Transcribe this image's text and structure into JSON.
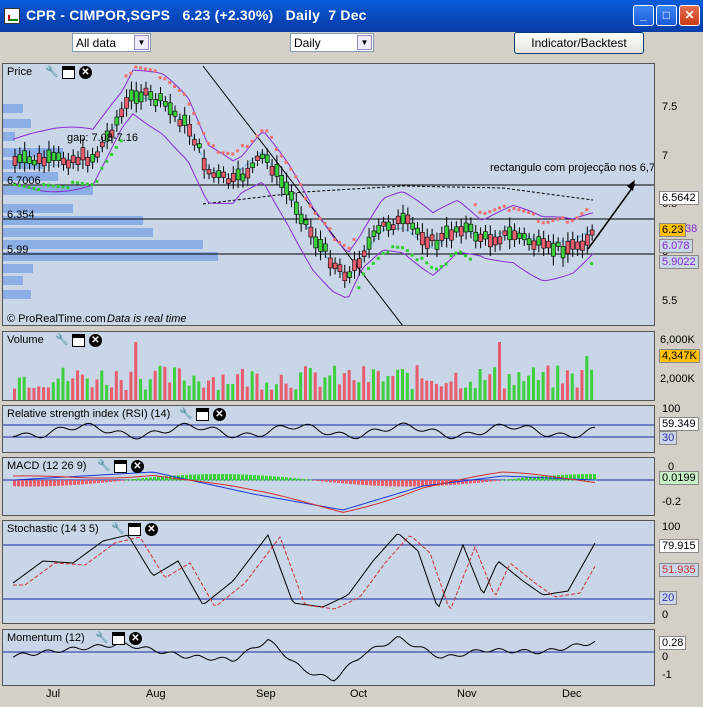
{
  "window": {
    "title": "CPR - CIMPOR,SGPS   6.23 (+2.30%)   Daily  7 Dec",
    "buttons": {
      "minimize": "_",
      "maximize": "□",
      "close": "✕"
    }
  },
  "toolbar": {
    "range_select": "All data",
    "interval_select": "Daily",
    "indicator_button": "Indicator/Backtest"
  },
  "panels": {
    "price": {
      "title": "Price",
      "y_ticks": [
        "7.5",
        "7",
        "6.5",
        "6",
        "5.5"
      ],
      "badges": {
        "top": "6.5642",
        "last": "6.23",
        "last_suffix": "38",
        "mid": "6.078",
        "low": "5.9022"
      },
      "level_labels": [
        "6.7006",
        "6.354",
        "5.99"
      ],
      "annotations": {
        "gap": "gap: 7.08-7.16",
        "rect": "rectangulo com projecção nos 6,7"
      },
      "footer_brand": "© ProRealTime.com",
      "footer_note": "Data is real time",
      "colors": {
        "up": "#3cd03c",
        "down": "#e85c6c",
        "bollinger": "#8a2bd0",
        "sar_up": "#2fcf2f",
        "sar_down": "#f07070"
      }
    },
    "volume": {
      "title": "Volume",
      "y_ticks": [
        "6,000K",
        "2,000K"
      ],
      "badge": "4,347K"
    },
    "rsi": {
      "title": "Relative strength index (RSI) (14)",
      "y_ticks": [
        "100"
      ],
      "badge_main": "59.349",
      "badge_sub": "30"
    },
    "macd": {
      "title": "MACD (12 26 9)",
      "y_ticks": [
        "0",
        "-0.2"
      ],
      "badge": "0.0199"
    },
    "stochastic": {
      "title": "Stochastic (14 3 5)",
      "y_ticks": [
        "100",
        "0"
      ],
      "badges": [
        "79.915",
        "51.935",
        "20"
      ]
    },
    "momentum": {
      "title": "Momentum (12)",
      "y_ticks": [
        "0",
        "-1"
      ],
      "badge": "0.28"
    }
  },
  "x_axis": [
    "Jul",
    "Aug",
    "Sep",
    "Oct",
    "Nov",
    "Dec"
  ]
}
